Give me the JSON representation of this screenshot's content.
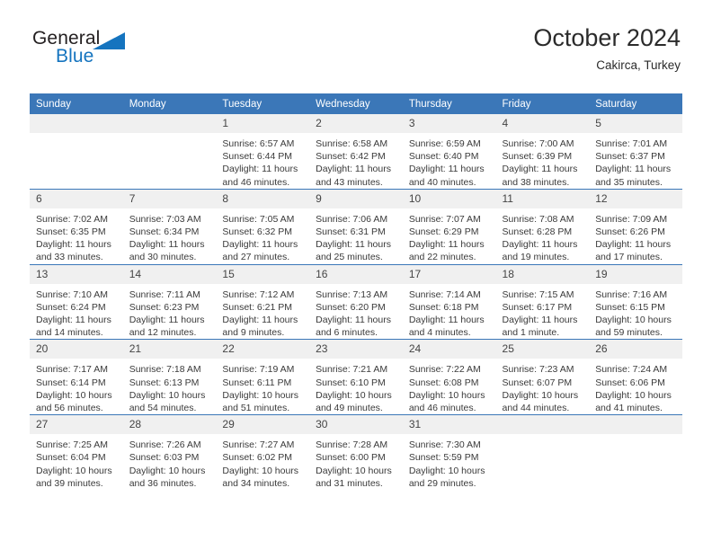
{
  "brand": {
    "name_top": "General",
    "name_bottom": "Blue",
    "accent_color": "#1574bf"
  },
  "header": {
    "title": "October 2024",
    "subtitle": "Cakirca, Turkey"
  },
  "theme": {
    "header_blue": "#3b77b8",
    "daynum_band": "#f0f0f0",
    "text": "#3a3a3a"
  },
  "weekdays": [
    "Sunday",
    "Monday",
    "Tuesday",
    "Wednesday",
    "Thursday",
    "Friday",
    "Saturday"
  ],
  "weeks": [
    [
      {
        "day": "",
        "blank": true
      },
      {
        "day": "",
        "blank": true
      },
      {
        "day": "1",
        "sunrise": "Sunrise: 6:57 AM",
        "sunset": "Sunset: 6:44 PM",
        "daylight": "Daylight: 11 hours and 46 minutes."
      },
      {
        "day": "2",
        "sunrise": "Sunrise: 6:58 AM",
        "sunset": "Sunset: 6:42 PM",
        "daylight": "Daylight: 11 hours and 43 minutes."
      },
      {
        "day": "3",
        "sunrise": "Sunrise: 6:59 AM",
        "sunset": "Sunset: 6:40 PM",
        "daylight": "Daylight: 11 hours and 40 minutes."
      },
      {
        "day": "4",
        "sunrise": "Sunrise: 7:00 AM",
        "sunset": "Sunset: 6:39 PM",
        "daylight": "Daylight: 11 hours and 38 minutes."
      },
      {
        "day": "5",
        "sunrise": "Sunrise: 7:01 AM",
        "sunset": "Sunset: 6:37 PM",
        "daylight": "Daylight: 11 hours and 35 minutes."
      }
    ],
    [
      {
        "day": "6",
        "sunrise": "Sunrise: 7:02 AM",
        "sunset": "Sunset: 6:35 PM",
        "daylight": "Daylight: 11 hours and 33 minutes."
      },
      {
        "day": "7",
        "sunrise": "Sunrise: 7:03 AM",
        "sunset": "Sunset: 6:34 PM",
        "daylight": "Daylight: 11 hours and 30 minutes."
      },
      {
        "day": "8",
        "sunrise": "Sunrise: 7:05 AM",
        "sunset": "Sunset: 6:32 PM",
        "daylight": "Daylight: 11 hours and 27 minutes."
      },
      {
        "day": "9",
        "sunrise": "Sunrise: 7:06 AM",
        "sunset": "Sunset: 6:31 PM",
        "daylight": "Daylight: 11 hours and 25 minutes."
      },
      {
        "day": "10",
        "sunrise": "Sunrise: 7:07 AM",
        "sunset": "Sunset: 6:29 PM",
        "daylight": "Daylight: 11 hours and 22 minutes."
      },
      {
        "day": "11",
        "sunrise": "Sunrise: 7:08 AM",
        "sunset": "Sunset: 6:28 PM",
        "daylight": "Daylight: 11 hours and 19 minutes."
      },
      {
        "day": "12",
        "sunrise": "Sunrise: 7:09 AM",
        "sunset": "Sunset: 6:26 PM",
        "daylight": "Daylight: 11 hours and 17 minutes."
      }
    ],
    [
      {
        "day": "13",
        "sunrise": "Sunrise: 7:10 AM",
        "sunset": "Sunset: 6:24 PM",
        "daylight": "Daylight: 11 hours and 14 minutes."
      },
      {
        "day": "14",
        "sunrise": "Sunrise: 7:11 AM",
        "sunset": "Sunset: 6:23 PM",
        "daylight": "Daylight: 11 hours and 12 minutes."
      },
      {
        "day": "15",
        "sunrise": "Sunrise: 7:12 AM",
        "sunset": "Sunset: 6:21 PM",
        "daylight": "Daylight: 11 hours and 9 minutes."
      },
      {
        "day": "16",
        "sunrise": "Sunrise: 7:13 AM",
        "sunset": "Sunset: 6:20 PM",
        "daylight": "Daylight: 11 hours and 6 minutes."
      },
      {
        "day": "17",
        "sunrise": "Sunrise: 7:14 AM",
        "sunset": "Sunset: 6:18 PM",
        "daylight": "Daylight: 11 hours and 4 minutes."
      },
      {
        "day": "18",
        "sunrise": "Sunrise: 7:15 AM",
        "sunset": "Sunset: 6:17 PM",
        "daylight": "Daylight: 11 hours and 1 minute."
      },
      {
        "day": "19",
        "sunrise": "Sunrise: 7:16 AM",
        "sunset": "Sunset: 6:15 PM",
        "daylight": "Daylight: 10 hours and 59 minutes."
      }
    ],
    [
      {
        "day": "20",
        "sunrise": "Sunrise: 7:17 AM",
        "sunset": "Sunset: 6:14 PM",
        "daylight": "Daylight: 10 hours and 56 minutes."
      },
      {
        "day": "21",
        "sunrise": "Sunrise: 7:18 AM",
        "sunset": "Sunset: 6:13 PM",
        "daylight": "Daylight: 10 hours and 54 minutes."
      },
      {
        "day": "22",
        "sunrise": "Sunrise: 7:19 AM",
        "sunset": "Sunset: 6:11 PM",
        "daylight": "Daylight: 10 hours and 51 minutes."
      },
      {
        "day": "23",
        "sunrise": "Sunrise: 7:21 AM",
        "sunset": "Sunset: 6:10 PM",
        "daylight": "Daylight: 10 hours and 49 minutes."
      },
      {
        "day": "24",
        "sunrise": "Sunrise: 7:22 AM",
        "sunset": "Sunset: 6:08 PM",
        "daylight": "Daylight: 10 hours and 46 minutes."
      },
      {
        "day": "25",
        "sunrise": "Sunrise: 7:23 AM",
        "sunset": "Sunset: 6:07 PM",
        "daylight": "Daylight: 10 hours and 44 minutes."
      },
      {
        "day": "26",
        "sunrise": "Sunrise: 7:24 AM",
        "sunset": "Sunset: 6:06 PM",
        "daylight": "Daylight: 10 hours and 41 minutes."
      }
    ],
    [
      {
        "day": "27",
        "sunrise": "Sunrise: 7:25 AM",
        "sunset": "Sunset: 6:04 PM",
        "daylight": "Daylight: 10 hours and 39 minutes."
      },
      {
        "day": "28",
        "sunrise": "Sunrise: 7:26 AM",
        "sunset": "Sunset: 6:03 PM",
        "daylight": "Daylight: 10 hours and 36 minutes."
      },
      {
        "day": "29",
        "sunrise": "Sunrise: 7:27 AM",
        "sunset": "Sunset: 6:02 PM",
        "daylight": "Daylight: 10 hours and 34 minutes."
      },
      {
        "day": "30",
        "sunrise": "Sunrise: 7:28 AM",
        "sunset": "Sunset: 6:00 PM",
        "daylight": "Daylight: 10 hours and 31 minutes."
      },
      {
        "day": "31",
        "sunrise": "Sunrise: 7:30 AM",
        "sunset": "Sunset: 5:59 PM",
        "daylight": "Daylight: 10 hours and 29 minutes."
      },
      {
        "day": "",
        "blank": true
      },
      {
        "day": "",
        "blank": true
      }
    ]
  ]
}
